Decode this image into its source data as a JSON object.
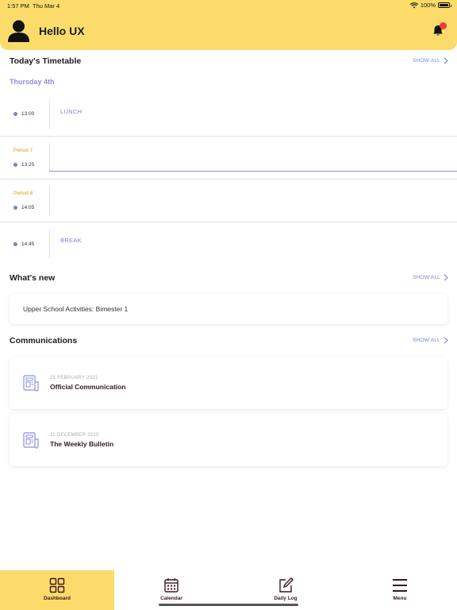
{
  "status_bar": {
    "time": "1:57 PM",
    "date": "Thu Mar 4",
    "battery": "100%",
    "wifi_icon": "wifi-icon",
    "battery_icon": "battery-icon"
  },
  "header": {
    "greeting": "Hello UX",
    "avatar_icon": "avatar-icon",
    "bell_icon": "bell-icon",
    "bell_badge": ""
  },
  "colors": {
    "accent_yellow": "#fbdc6a",
    "accent_purple": "#7b7fd8",
    "period_gold": "#d4a017",
    "badge_red": "#ef3b3b",
    "title_dark": "#3a1620"
  },
  "timetable": {
    "title": "Today's Timetable",
    "show_all": "SHOW ALL",
    "day": "Thursday 4th",
    "rows": [
      {
        "period": "",
        "time": "13:00",
        "event": "LUNCH"
      },
      {
        "period": "Period 7",
        "time": "13:25",
        "event": ""
      },
      {
        "period": "Period 8",
        "time": "14:05",
        "event": ""
      },
      {
        "period": "",
        "time": "14:45",
        "event": "BREAK"
      }
    ]
  },
  "whats_new": {
    "title": "What's new",
    "show_all": "SHOW ALL",
    "items": [
      {
        "title": "Upper School Activities: Bimester 1"
      }
    ]
  },
  "communications": {
    "title": "Communications",
    "show_all": "SHOW ALL",
    "items": [
      {
        "date": "25 FEBRUARY 2021",
        "title": "Official Communication",
        "icon": "document-icon"
      },
      {
        "date": "11 DECEMBER 2020",
        "title": "The Weekly Bulletin",
        "icon": "document-icon"
      }
    ]
  },
  "tab_bar": {
    "tabs": [
      {
        "label": "Dashboard",
        "icon": "dashboard-grid-icon",
        "active": true
      },
      {
        "label": "Calendar",
        "icon": "calendar-icon",
        "active": false
      },
      {
        "label": "Daily Log",
        "icon": "edit-note-icon",
        "active": false
      },
      {
        "label": "Menu",
        "icon": "hamburger-menu-icon",
        "active": false
      }
    ]
  }
}
